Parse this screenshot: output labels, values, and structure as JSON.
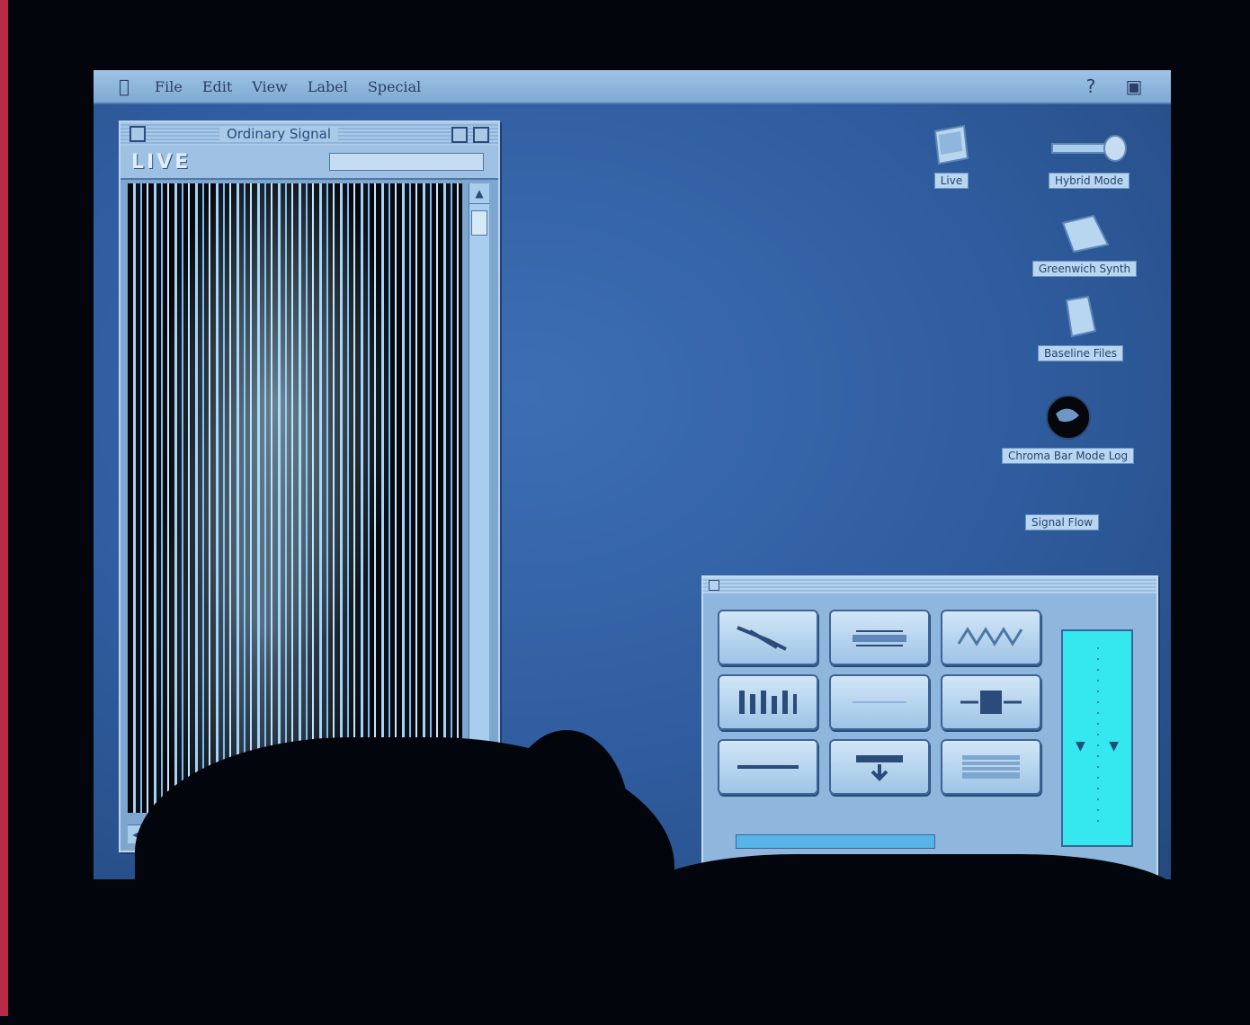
{
  "menubar": {
    "apple_icon": "apple-icon",
    "items": [
      "File",
      "Edit",
      "View",
      "Label",
      "Special"
    ],
    "right_icons": [
      "balloon-help-icon",
      "application-menu-icon"
    ]
  },
  "window": {
    "title": "Ordinary Signal",
    "logo": "LIVE",
    "toolbar_field": ""
  },
  "desktop_icons": [
    {
      "name": "folder-icon",
      "label": "Live"
    },
    {
      "name": "microphone-icon",
      "label": "Hybrid Mode"
    },
    {
      "name": "folder-icon",
      "label": "Greenwich Synth"
    },
    {
      "name": "document-icon",
      "label": "Baseline Files"
    },
    {
      "name": "globe-icon",
      "label": "Chroma Bar Mode Log"
    },
    {
      "name": "document-icon",
      "label": "Signal Flow"
    }
  ],
  "palette": {
    "tools": [
      "waveform-pen-icon",
      "sine-level-icon",
      "waveform-pattern-icon",
      "equalizer-bars-icon",
      "blank-tool-icon",
      "stereo-split-icon",
      "flat-line-icon",
      "arrow-down-icon",
      "noise-fill-icon"
    ],
    "meter_level": 0.5,
    "progress": 0.72
  }
}
